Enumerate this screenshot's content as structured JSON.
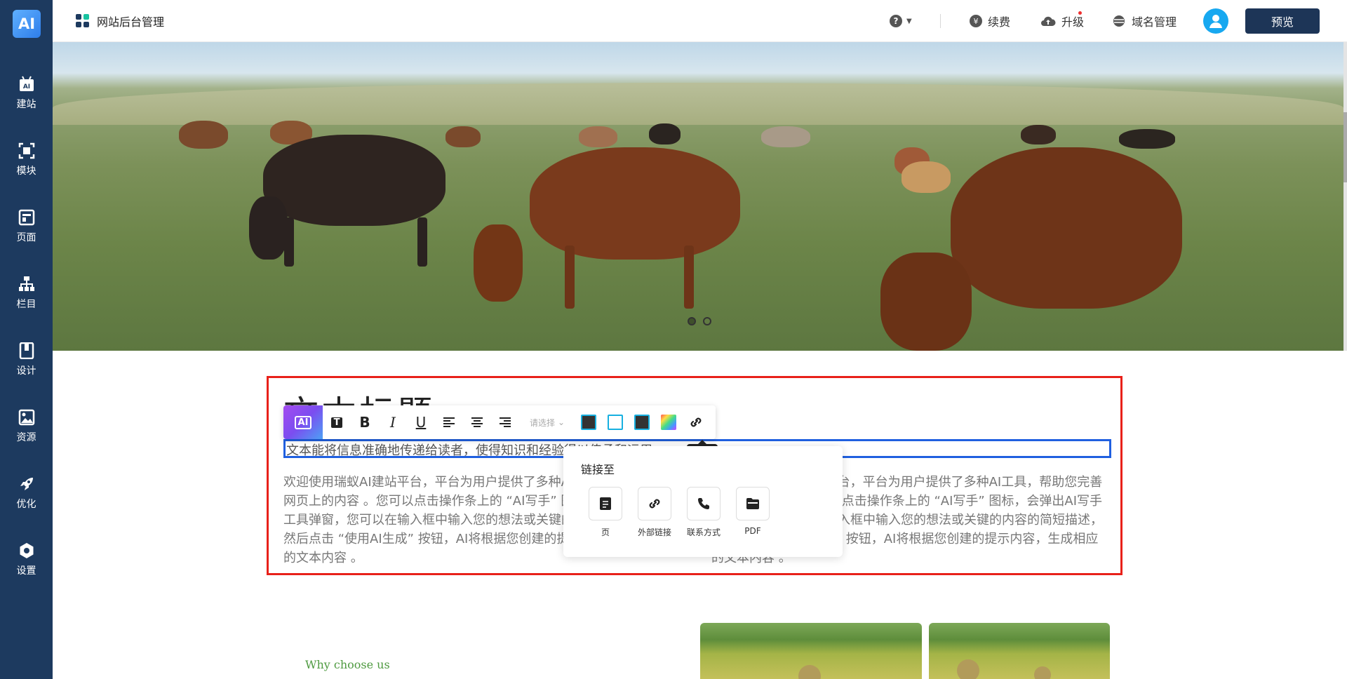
{
  "app": {
    "logo_text": "AI",
    "title": "网站后台管理"
  },
  "sidebar": {
    "items": [
      {
        "label": "建站",
        "icon": "ai-site-icon"
      },
      {
        "label": "模块",
        "icon": "module-icon"
      },
      {
        "label": "页面",
        "icon": "page-icon"
      },
      {
        "label": "栏目",
        "icon": "column-tree-icon"
      },
      {
        "label": "设计",
        "icon": "design-icon"
      },
      {
        "label": "资源",
        "icon": "resource-image-icon"
      },
      {
        "label": "优化",
        "icon": "rocket-icon"
      },
      {
        "label": "设置",
        "icon": "settings-icon"
      }
    ]
  },
  "topbar": {
    "help_label": "?",
    "renew_label": "续费",
    "upgrade_label": "升级",
    "domain_label": "域名管理",
    "preview_label": "预览"
  },
  "colors": {
    "sidebar": "#1d3a5f",
    "accent": "#17a8f0",
    "selection_red": "#e8211a",
    "selection_blue": "#2060e0",
    "preview_button": "#1d3557"
  },
  "module": {
    "title": "文本标题",
    "subtitle": "文本能将信息准确地传递给读者，使得知识和经验得以传承和运用",
    "para_left": "欢迎使用瑞蚁AI建站平台，平台为用户提供了多种AI工具，帮助您完善网页上的内容 。您可以点击操作条上的 “AI写手” 图标，会弹出AI写手工具弹窗，您可以在输入框中输入您的想法或关键的内容的简短描述，然后点击 “使用AI生成” 按钮，AI将根据您创建的提示内容，生成相应的文本内容 。",
    "para_right": "欢迎使用瑞蚁AI建站平台，平台为用户提供了多种AI工具，帮助您完善网页上的内容 。您可以点击操作条上的 “AI写手” 图标，会弹出AI写手工具弹窗，您可以在输入框中输入您的想法或关键的内容的简短描述，然后点击 “使用AI生成” 按钮，AI将根据您创建的提示内容，生成相应的文本内容 。"
  },
  "toolbar": {
    "ai_label": "AI",
    "select_placeholder": "请选择",
    "tooltip": "链接"
  },
  "link_popup": {
    "title": "链接至",
    "options": [
      {
        "label": "页",
        "icon": "page-doc-icon"
      },
      {
        "label": "外部链接",
        "icon": "external-link-icon"
      },
      {
        "label": "联系方式",
        "icon": "phone-icon"
      },
      {
        "label": "PDF",
        "icon": "folder-icon"
      }
    ]
  },
  "section": {
    "why_choose": "Why choose us"
  }
}
